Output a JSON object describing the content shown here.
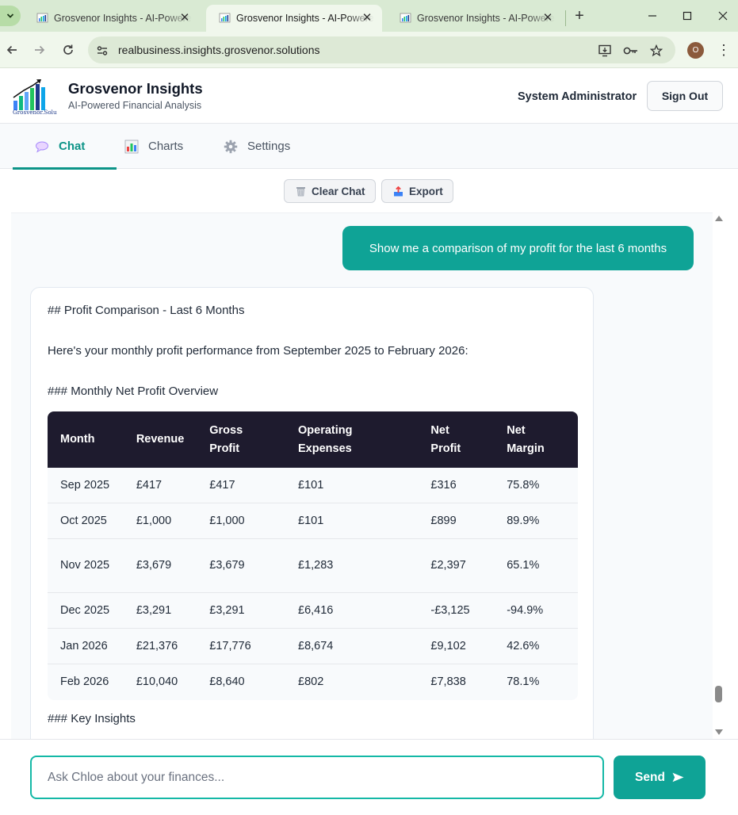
{
  "browser": {
    "tabs": [
      {
        "title": "Grosvenor Insights - AI-Powered Financial Analysis",
        "active": false
      },
      {
        "title": "Grosvenor Insights - AI-Powered Financial Analysis",
        "active": true
      },
      {
        "title": "Grosvenor Insights - AI-Powered Financial Analysis",
        "active": false
      }
    ],
    "new_tab": "+",
    "url": "realbusiness.insights.grosvenor.solutions",
    "profile_initial": "O"
  },
  "header": {
    "logo_text": "Grosvenor.Solutions",
    "title": "Grosvenor Insights",
    "subtitle": "AI-Powered Financial Analysis",
    "user": "System Administrator",
    "signout_label": "Sign Out"
  },
  "nav": {
    "tabs": [
      {
        "label": "Chat",
        "icon": "speech-bubble-icon",
        "active": true
      },
      {
        "label": "Charts",
        "icon": "bar-chart-icon",
        "active": false
      },
      {
        "label": "Settings",
        "icon": "gear-icon",
        "active": false
      }
    ]
  },
  "actions": {
    "clear_label": "Clear Chat",
    "export_label": "Export"
  },
  "chat": {
    "user_message": "Show me a comparison of my profit for the last 6 months",
    "ai_heading": "## Profit Comparison - Last 6 Months",
    "ai_intro": "Here's your monthly profit performance from September 2025 to February 2026:",
    "ai_subheading": "### Monthly Net Profit Overview",
    "table": {
      "headers": [
        "Month",
        "Revenue",
        "Gross Profit",
        "Operating Expenses",
        "Net Profit",
        "Net Margin"
      ],
      "rows": [
        [
          "Sep 2025",
          "£417",
          "£417",
          "£101",
          "£316",
          "75.8%"
        ],
        [
          "Oct 2025",
          "£1,000",
          "£1,000",
          "£101",
          "£899",
          "89.9%"
        ],
        [
          "Nov 2025",
          "£3,679",
          "£3,679",
          "£1,283",
          "£2,397",
          "65.1%"
        ],
        [
          "Dec 2025",
          "£3,291",
          "£3,291",
          "£6,416",
          "-£3,125",
          "-94.9%"
        ],
        [
          "Jan 2026",
          "£21,376",
          "£17,776",
          "£8,674",
          "£9,102",
          "42.6%"
        ],
        [
          "Feb 2026",
          "£10,040",
          "£8,640",
          "£802",
          "£7,838",
          "78.1%"
        ]
      ]
    },
    "ai_insights_heading": "### Key Insights"
  },
  "input": {
    "placeholder": "Ask Chloe about your finances...",
    "value": "",
    "send_label": "Send"
  },
  "colors": {
    "accent": "#0fa396",
    "table_header": "#1e1b2e",
    "browser_frame": "#d9ead3"
  }
}
